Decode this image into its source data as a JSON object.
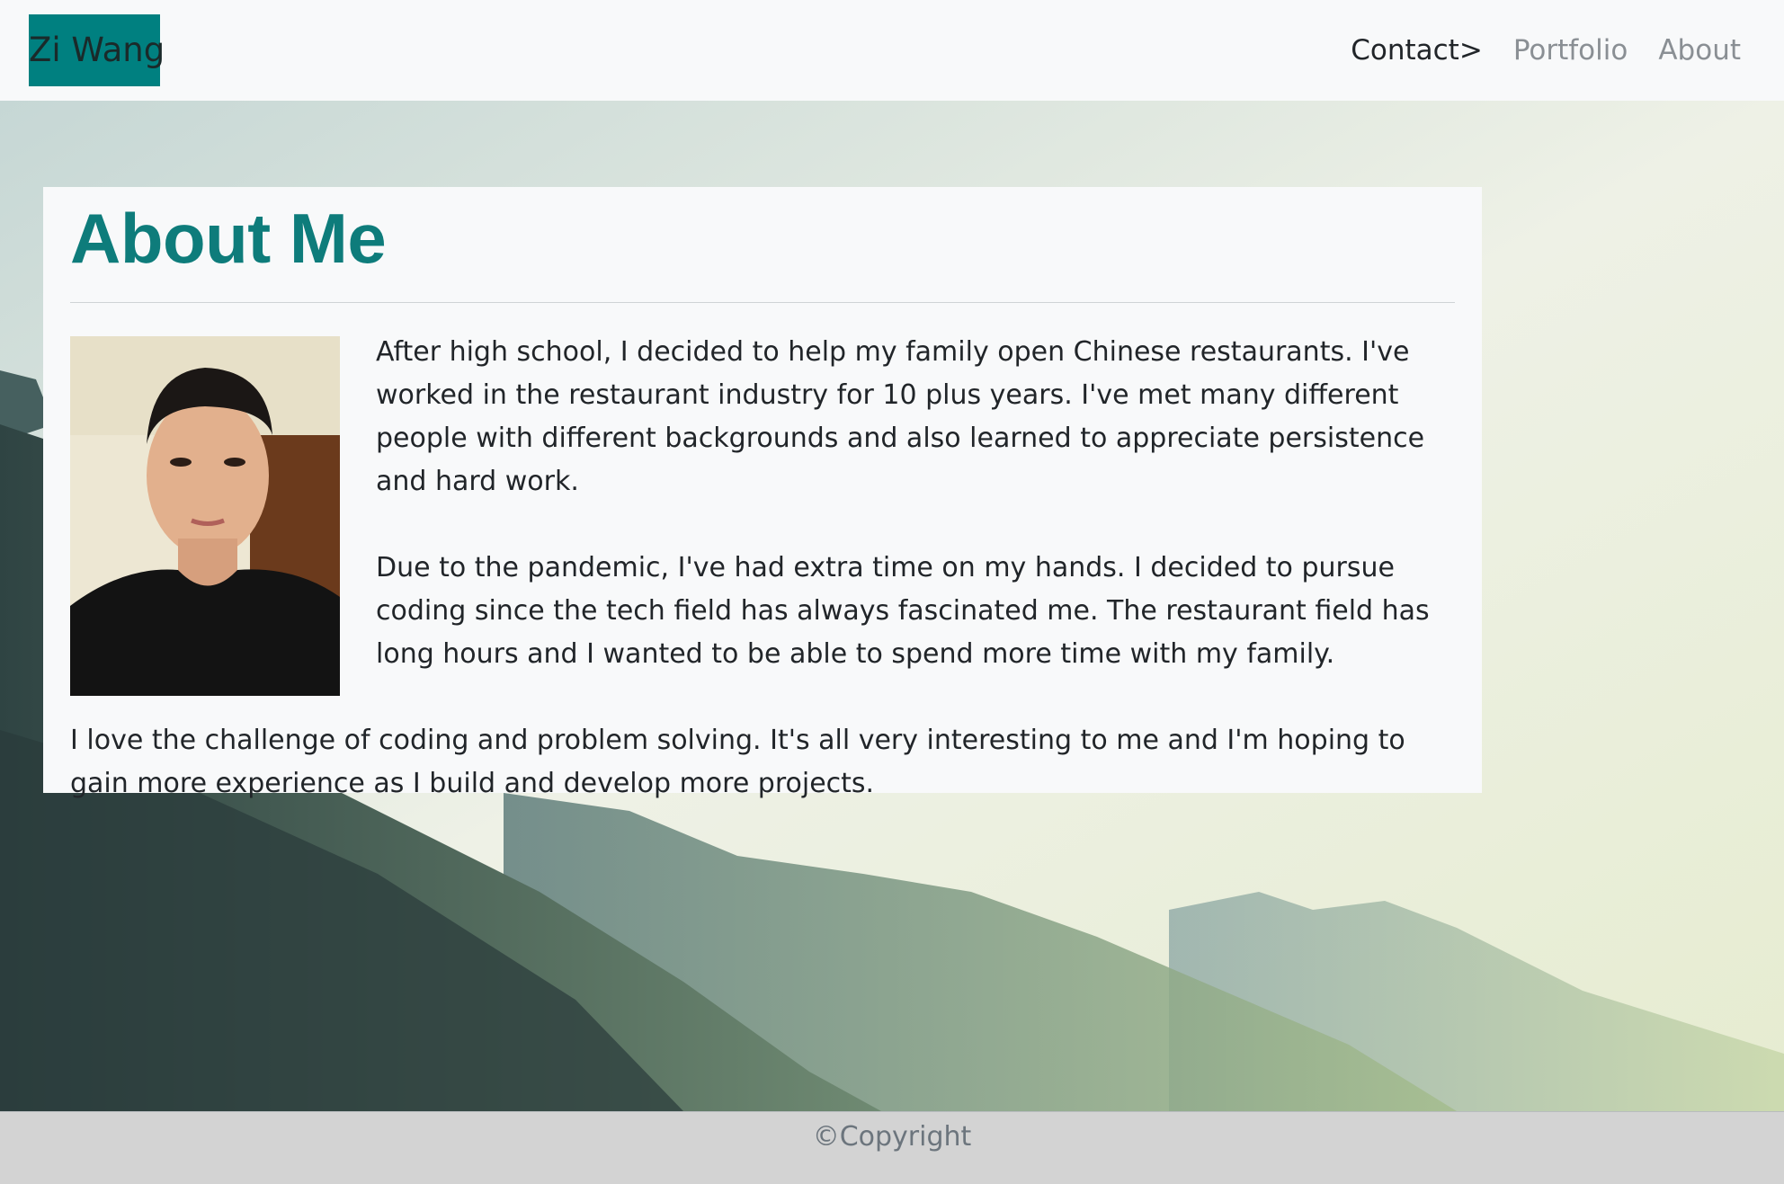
{
  "navbar": {
    "brand": "Zi Wang",
    "links": [
      {
        "label": "Contact>"
      },
      {
        "label": "Portfolio"
      },
      {
        "label": "About"
      }
    ]
  },
  "about": {
    "title": "About Me",
    "paragraphs": [
      "After high school, I decided to help my family open Chinese restaurants. I've worked in the restaurant industry for 10 plus years. I've met many different people with different backgrounds and also learned to appreciate persistence and hard work.",
      "Due to the pandemic, I've had extra time on my hands. I decided to pursue coding since the tech field has always fascinated me. The restaurant field has long hours and I wanted to be able to spend more time with my family.",
      "I love the challenge of coding and problem solving. It's all very interesting to me and I'm hoping to gain more experience as I build and develop more projects."
    ]
  },
  "footer": {
    "text": "©Copyright"
  },
  "colors": {
    "brand_bg": "#008080",
    "title": "#0e7c7b",
    "footer_bg": "#d3d3d3"
  }
}
